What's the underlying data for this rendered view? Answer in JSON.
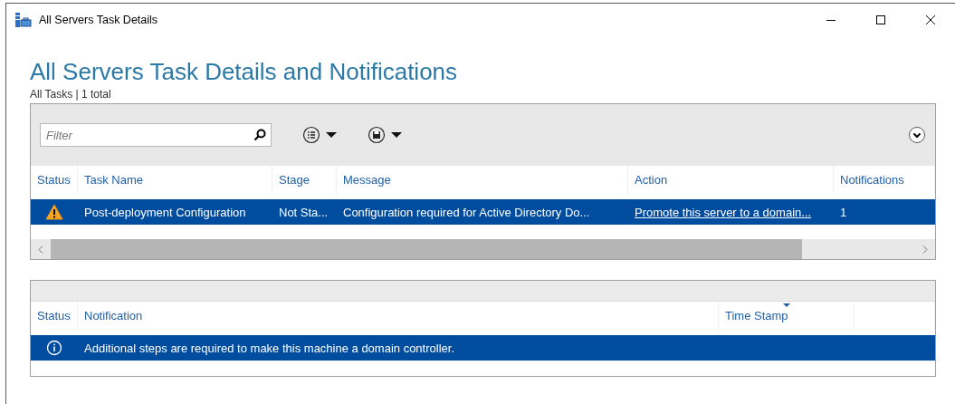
{
  "window": {
    "title": "All Servers Task Details"
  },
  "heading": "All Servers Task Details and Notifications",
  "subtitle": "All Tasks | 1 total",
  "filter": {
    "placeholder": "Filter"
  },
  "tasks": {
    "columns": [
      {
        "label": "Status"
      },
      {
        "label": "Task Name"
      },
      {
        "label": "Stage"
      },
      {
        "label": "Message"
      },
      {
        "label": "Action"
      },
      {
        "label": "Notifications"
      }
    ],
    "rows": [
      {
        "kind": "warning",
        "selected": true,
        "task_name": "Post-deployment Configuration",
        "stage": "Not Sta...",
        "message": "Configuration required for Active Directory Do...",
        "action": "Promote this server to a domain...",
        "notifications": "1"
      }
    ]
  },
  "notifications": {
    "columns": [
      {
        "label": "Status",
        "sorted": false
      },
      {
        "label": "Notification",
        "sorted": false
      },
      {
        "label": "Time Stamp",
        "sorted": true
      }
    ],
    "rows": [
      {
        "kind": "info",
        "selected": true,
        "notification": "Additional steps are required to make this machine a domain controller."
      }
    ]
  }
}
